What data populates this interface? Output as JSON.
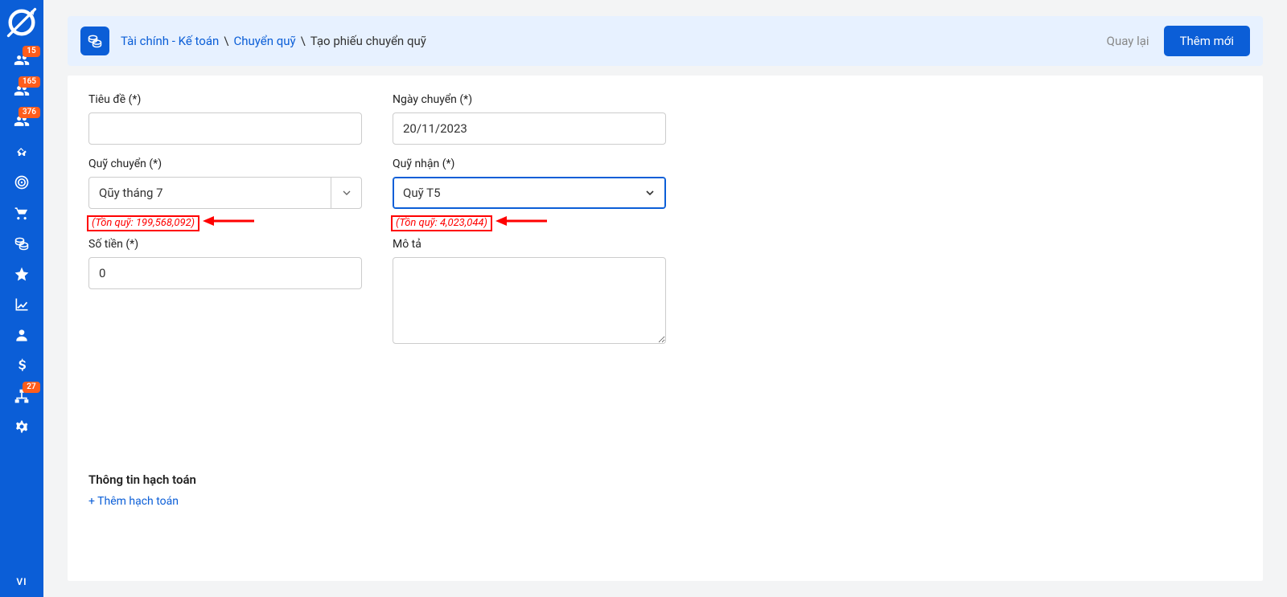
{
  "sidebar": {
    "badges": {
      "person1": "15",
      "person2": "165",
      "person3": "376",
      "org": "27"
    },
    "lang": "VI"
  },
  "header": {
    "crumb1": "Tài chính - Kế toán",
    "crumb2": "Chuyển quỹ",
    "current": "Tạo phiếu chuyển quỹ",
    "back": "Quay lại",
    "add_btn": "Thêm mới"
  },
  "form": {
    "title_label": "Tiêu đề (*)",
    "title_value": "",
    "date_label": "Ngày chuyển (*)",
    "date_value": "20/11/2023",
    "from_fund_label": "Quỹ chuyển (*)",
    "from_fund_value": "Qũy tháng 7",
    "from_fund_balance": "(Tồn quỹ: 199,568,092)",
    "to_fund_label": "Quỹ nhận (*)",
    "to_fund_value": "Quỹ T5",
    "to_fund_balance": "(Tồn quỹ: 4,023,044)",
    "amount_label": "Số tiền (*)",
    "amount_value": "0",
    "desc_label": "Mô tả",
    "desc_value": ""
  },
  "accounting": {
    "section_title": "Thông tin hạch toán",
    "add_link": "+ Thêm hạch toán"
  },
  "colors": {
    "primary": "#0b5ed7",
    "badge": "#ff5d1b",
    "danger": "#ff0000",
    "header_bg": "#e7f1ff"
  }
}
